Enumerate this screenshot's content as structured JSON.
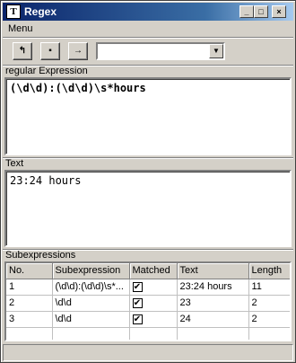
{
  "window": {
    "title": "Regex",
    "icon_letter": "T"
  },
  "menu": {
    "items": [
      "Menu"
    ]
  },
  "toolbar": {
    "buttons": [
      "open",
      "stop",
      "run"
    ],
    "combo_value": ""
  },
  "regex_section": {
    "label": "regular Expression",
    "value": "(\\d\\d):(\\d\\d)\\s*hours"
  },
  "text_section": {
    "label": "Text",
    "value": "23:24 hours"
  },
  "subexpr_section": {
    "label": "Subexpressions",
    "columns": [
      "No.",
      "Subexpression",
      "Matched",
      "Text",
      "Length"
    ],
    "rows": [
      {
        "no": "1",
        "subexpression": "(\\d\\d):(\\d\\d)\\s*...",
        "matched": true,
        "text": "23:24 hours",
        "length": "11"
      },
      {
        "no": "2",
        "subexpression": "\\d\\d",
        "matched": true,
        "text": "23",
        "length": "2"
      },
      {
        "no": "3",
        "subexpression": "\\d\\d",
        "matched": true,
        "text": "24",
        "length": "2"
      }
    ]
  },
  "status": {
    "text": ""
  }
}
